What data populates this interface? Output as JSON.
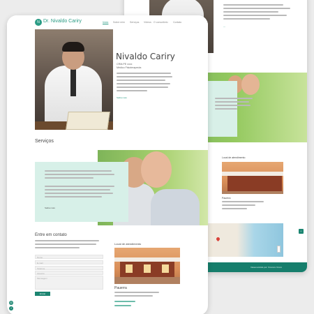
{
  "header": {
    "logo_icon": "logo-mark-icon",
    "logo_mark": "N",
    "logo_text": "Dr. Nivaldo Cariry",
    "nav": [
      "Início",
      "Sobre mim",
      "Serviços",
      "Vídeos",
      "O consultório",
      "Contato"
    ]
  },
  "hero": {
    "name": "Nivaldo Cariry",
    "crm": "CRM-PE xxxx",
    "role": "Médico Fisioterapeuta",
    "link": "Saiba mais"
  },
  "services": {
    "title": "Serviços",
    "link": "Saiba mais"
  },
  "contact": {
    "title": "Entre em contato",
    "fields": [
      "Nome",
      "E-mail",
      "Telefone",
      "Assunto"
    ],
    "message_placeholder": "Mensagem",
    "send": "Enviar"
  },
  "location": {
    "title": "Local de atendimento",
    "city": "Pauerra"
  },
  "back": {
    "footer": "Desenvolvido por: Xxxxxxx Xxxxx",
    "location_title": "Local de atendimento",
    "city": "Pauerra"
  },
  "social": {
    "instagram_icon": "instagram-icon",
    "facebook_icon": "facebook-icon"
  },
  "colors": {
    "primary": "#1c8571",
    "accent": "#2a9b84",
    "mint": "#d7f0e8"
  }
}
